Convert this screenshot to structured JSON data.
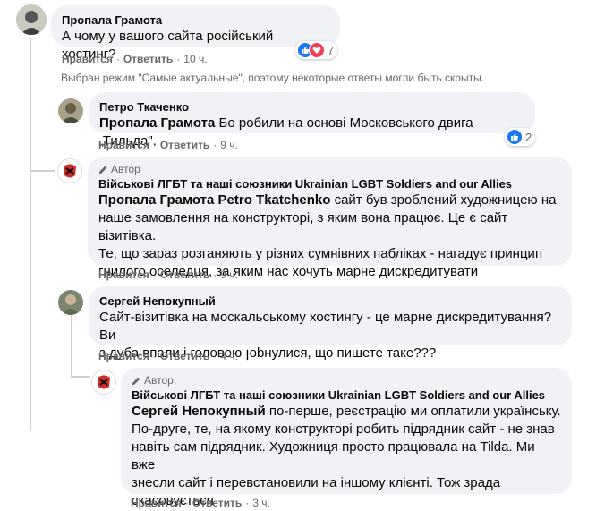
{
  "comments": [
    {
      "author": "Пропала Грамота",
      "text": "А чому у вашого сайта російський хостинг?",
      "actions": {
        "like": "Нравится",
        "reply": "Ответить",
        "time": "10 ч."
      },
      "reactions_count": "7"
    },
    {
      "author": "Петро Ткаченко",
      "mention": "Пропала Грамота",
      "text": "Бо робили на основі Московського двига „Тильда\".",
      "actions": {
        "like": "Нравится",
        "reply": "Ответить",
        "time": "9 ч."
      },
      "reactions_count": "2"
    },
    {
      "badge": "Автор",
      "author": "Військові ЛГБТ та наші союзники Ukrainian LGBT Soldiers and our Allies",
      "mention": "Пропала Грамота Petro Tkatchenko",
      "lines": [
        "сайт був зроблений художницею на",
        "наше замовлення на конструкторі, з яким вона працює. Це є сайт візитівка.",
        "Те, що зараз розганяють у різних сумнівних пабліках - нагадує принцип",
        "гнилого оселедця, за яким нас хочуть марне дискредитувати"
      ],
      "actions": {
        "like": "Нравится",
        "reply": "Ответить",
        "time": "9 ч."
      }
    },
    {
      "author": "Сергей Непокупный",
      "lines": [
        "Сайт-візитівка на москальському хостингу - це марне дискредитування? Ви",
        "з дуба впали і головою ꞁоbнулися, що пишете таке???"
      ],
      "actions": {
        "like": "Нравится",
        "reply": "Ответить",
        "time": "4 ч."
      }
    },
    {
      "badge": "Автор",
      "author": "Військові ЛГБТ та наші союзники Ukrainian LGBT Soldiers and our Allies",
      "mention": "Сергей Непокупный",
      "lines": [
        "по-перше, реєстрацію ми оплатили українську.",
        "По-друге, те, на якому конструкторі робить підрядник сайт - не знав",
        "навіть сам підрядник. Художниця просто працювала на Tilda. Ми вже",
        "знесли сайт і перевстановили на іншому клієнті. Тож зрада",
        "скасовується"
      ],
      "actions": {
        "like": "Нравится",
        "reply": "Ответить",
        "time": "3 ч."
      }
    }
  ],
  "notice": "Выбран режим \"Самые актуальные\", поэтому некоторые ответы могли быть скрыты.",
  "colors": {
    "bubble": "#f0f2f5",
    "meta": "#65676b",
    "like_blue": "#1877f2",
    "love_red": "#f33e58"
  },
  "icons": {
    "author_badge": "pencil-icon",
    "like": "thumbs-up-icon",
    "love": "heart-icon"
  }
}
